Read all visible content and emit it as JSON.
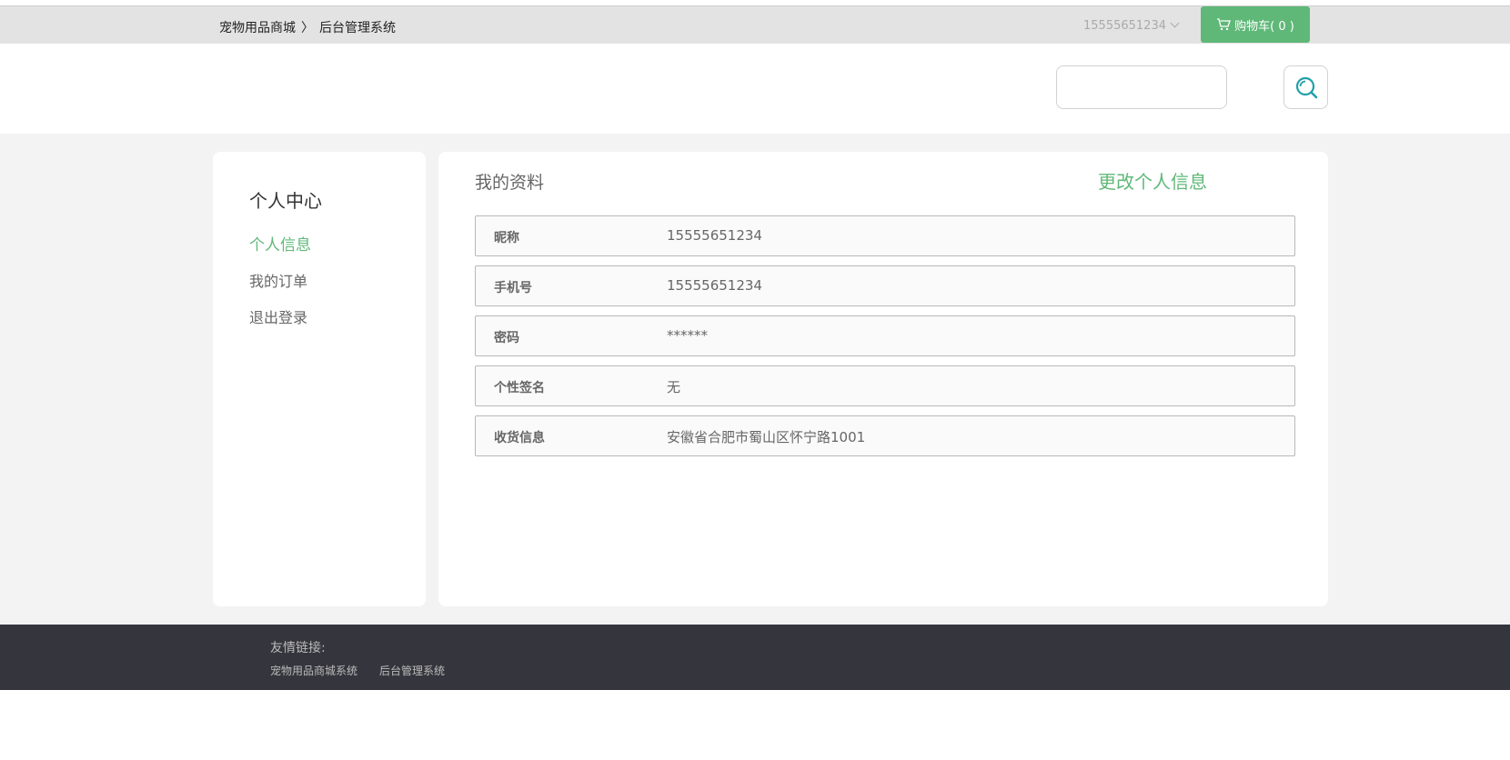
{
  "header": {
    "site_name": "宠物用品商城",
    "separator": "〉",
    "admin_link": "后台管理系统",
    "username": "15555651234",
    "cart_label": "购物车( 0 )"
  },
  "search": {
    "placeholder": "",
    "value": ""
  },
  "sidebar": {
    "title": "个人中心",
    "items": [
      {
        "label": "个人信息",
        "active": true
      },
      {
        "label": "我的订单",
        "active": false
      },
      {
        "label": "退出登录",
        "active": false
      }
    ]
  },
  "profile": {
    "title": "我的资料",
    "edit_label": "更改个人信息",
    "rows": [
      {
        "label": "昵称",
        "value": "15555651234"
      },
      {
        "label": "手机号",
        "value": "15555651234"
      },
      {
        "label": "密码",
        "value": "******"
      },
      {
        "label": "个性签名",
        "value": "无"
      },
      {
        "label": "收货信息",
        "value": "安徽省合肥市蜀山区怀宁路1001"
      }
    ]
  },
  "footer": {
    "title": "友情链接:",
    "links": [
      "宠物用品商城系统",
      "后台管理系统"
    ]
  },
  "colors": {
    "accent": "#5fb878",
    "footer_bg": "#35353d",
    "topbar_bg": "#e3e3e3"
  },
  "icons": {
    "cart": "cart-icon",
    "search": "search-icon",
    "dropdown": "chevron-down-icon"
  }
}
